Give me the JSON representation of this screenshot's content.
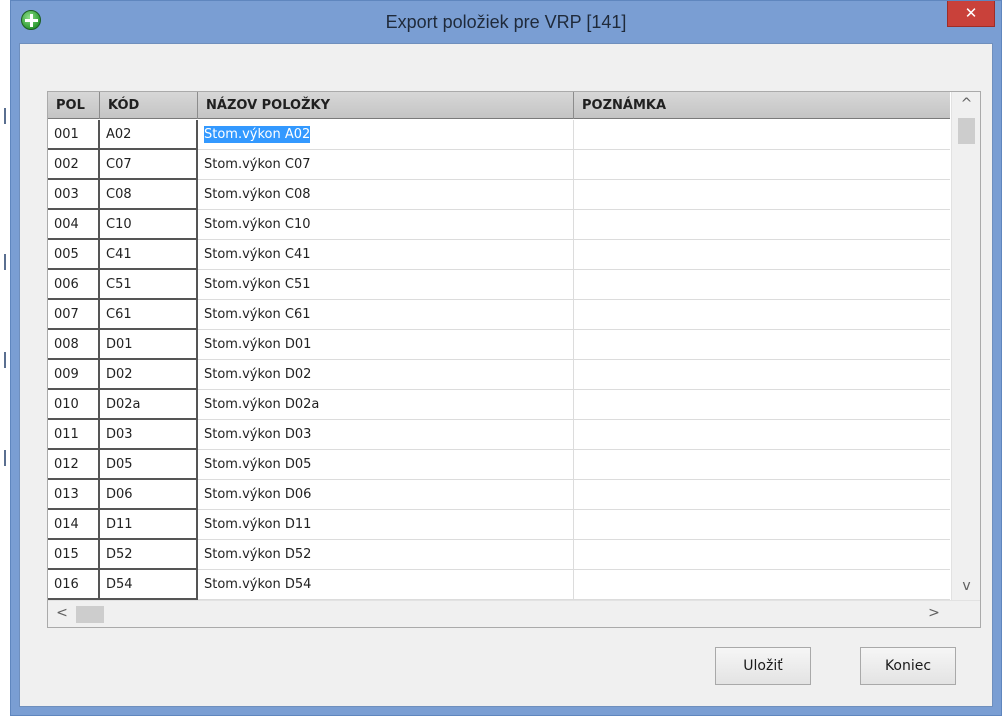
{
  "window": {
    "title": "Export položiek pre VRP [141]",
    "close_glyph": "✕",
    "icon": "green-plus-icon"
  },
  "grid": {
    "columns": [
      "POL",
      "KÓD",
      "NÁZOV POLOŽKY",
      "POZNÁMKA"
    ],
    "rows": [
      {
        "pol": "001",
        "kod": "A02",
        "nazov": "Stom.výkon A02",
        "pozn": ""
      },
      {
        "pol": "002",
        "kod": "C07",
        "nazov": "Stom.výkon C07",
        "pozn": ""
      },
      {
        "pol": "003",
        "kod": "C08",
        "nazov": "Stom.výkon C08",
        "pozn": ""
      },
      {
        "pol": "004",
        "kod": "C10",
        "nazov": "Stom.výkon C10",
        "pozn": ""
      },
      {
        "pol": "005",
        "kod": "C41",
        "nazov": "Stom.výkon C41",
        "pozn": ""
      },
      {
        "pol": "006",
        "kod": "C51",
        "nazov": "Stom.výkon C51",
        "pozn": ""
      },
      {
        "pol": "007",
        "kod": "C61",
        "nazov": "Stom.výkon C61",
        "pozn": ""
      },
      {
        "pol": "008",
        "kod": "D01",
        "nazov": "Stom.výkon D01",
        "pozn": ""
      },
      {
        "pol": "009",
        "kod": "D02",
        "nazov": "Stom.výkon D02",
        "pozn": ""
      },
      {
        "pol": "010",
        "kod": "D02a",
        "nazov": "Stom.výkon D02a",
        "pozn": ""
      },
      {
        "pol": "011",
        "kod": "D03",
        "nazov": "Stom.výkon D03",
        "pozn": ""
      },
      {
        "pol": "012",
        "kod": "D05",
        "nazov": "Stom.výkon D05",
        "pozn": ""
      },
      {
        "pol": "013",
        "kod": "D06",
        "nazov": "Stom.výkon D06",
        "pozn": ""
      },
      {
        "pol": "014",
        "kod": "D11",
        "nazov": "Stom.výkon D11",
        "pozn": ""
      },
      {
        "pol": "015",
        "kod": "D52",
        "nazov": "Stom.výkon D52",
        "pozn": ""
      },
      {
        "pol": "016",
        "kod": "D54",
        "nazov": "Stom.výkon D54",
        "pozn": ""
      }
    ],
    "selected_row": 0,
    "scroll": {
      "up": "^",
      "down": "v",
      "left": "<",
      "right": ">"
    }
  },
  "buttons": {
    "save": "Uložiť",
    "close": "Koniec"
  },
  "colors": {
    "selection": "#3399ff",
    "window_frame": "#7a9ed3",
    "close_button": "#c9413a"
  }
}
